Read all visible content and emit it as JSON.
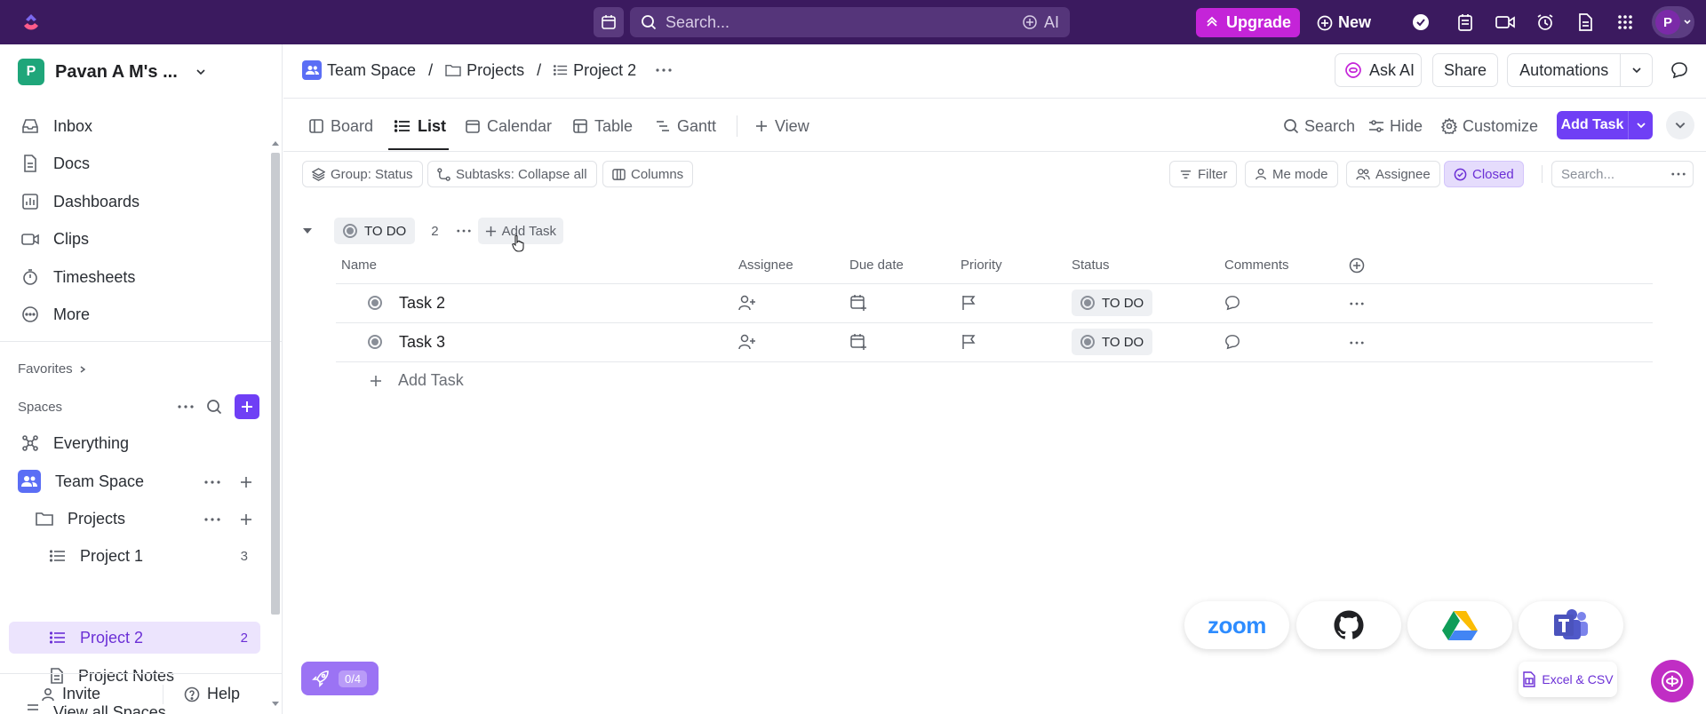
{
  "topbar": {
    "search_placeholder": "Search...",
    "ai_label": "AI",
    "upgrade_label": "Upgrade",
    "new_label": "New",
    "avatar_initial": "P"
  },
  "sidebar": {
    "workspace_initial": "P",
    "workspace_name": "Pavan A M's ...",
    "nav": [
      "Inbox",
      "Docs",
      "Dashboards",
      "Clips",
      "Timesheets",
      "More"
    ],
    "favorites_label": "Favorites",
    "spaces_label": "Spaces",
    "everything_label": "Everything",
    "team_space_label": "Team Space",
    "projects_label": "Projects",
    "lists": [
      {
        "label": "Project 1",
        "count": "3"
      },
      {
        "label": "Project 2",
        "count": "2"
      },
      {
        "label": "Project Notes",
        "count": ""
      }
    ],
    "view_all_label": "View all Spaces",
    "invite_label": "Invite",
    "help_label": "Help"
  },
  "breadcrumb": {
    "space": "Team Space",
    "folder": "Projects",
    "list": "Project 2"
  },
  "header": {
    "ask_ai": "Ask AI",
    "share": "Share",
    "automations": "Automations"
  },
  "views": {
    "tabs": [
      "Board",
      "List",
      "Calendar",
      "Table",
      "Gantt"
    ],
    "add_view": "View",
    "search": "Search",
    "hide": "Hide",
    "customize": "Customize",
    "add_task": "Add Task"
  },
  "filters": {
    "group": "Group: Status",
    "subtasks": "Subtasks: Collapse all",
    "columns": "Columns",
    "filter": "Filter",
    "me_mode": "Me mode",
    "assignee": "Assignee",
    "closed": "Closed",
    "search_placeholder": "Search..."
  },
  "group": {
    "status": "TO DO",
    "count": "2",
    "add_task": "Add Task"
  },
  "columns": [
    "Name",
    "Assignee",
    "Due date",
    "Priority",
    "Status",
    "Comments"
  ],
  "tasks": [
    {
      "name": "Task 2",
      "status": "TO DO"
    },
    {
      "name": "Task 3",
      "status": "TO DO"
    }
  ],
  "add_task_row": "Add Task",
  "bottom": {
    "rocket_progress": "0/4",
    "zoom_label": "zoom",
    "excel_label": "Excel & CSV"
  },
  "colors": {
    "topbar": "#3b1a5f",
    "accent": "#6f3ff5",
    "upgrade": "#c424d8"
  }
}
